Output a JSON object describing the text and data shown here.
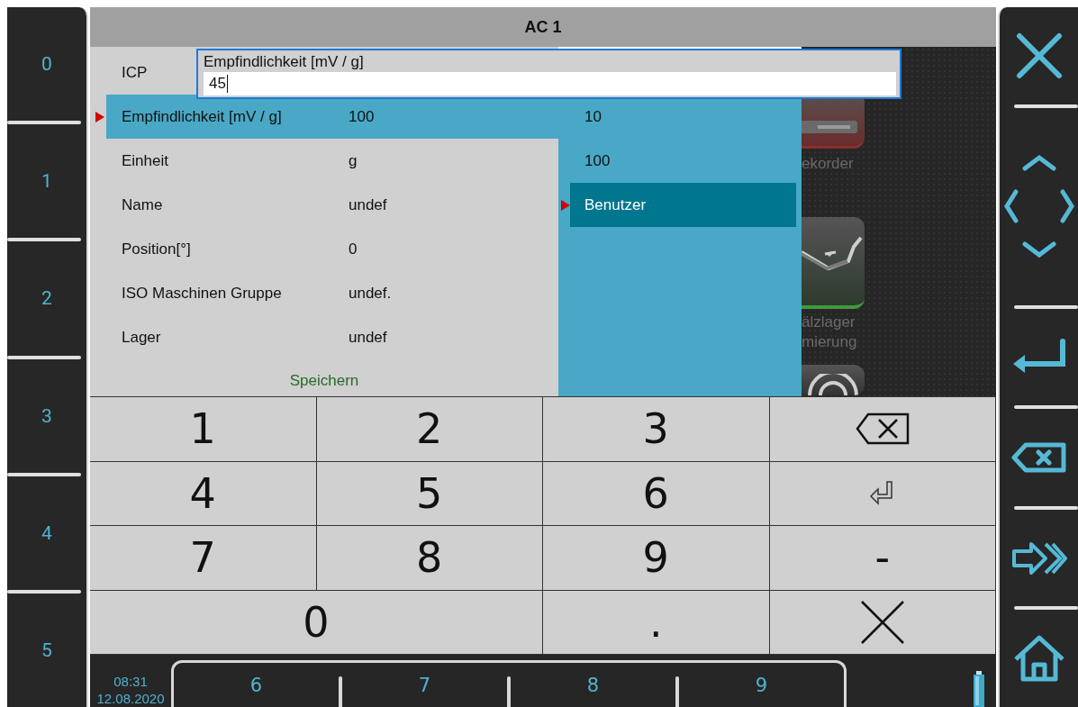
{
  "left_keys": [
    "0",
    "1",
    "2",
    "3",
    "4",
    "5"
  ],
  "window": {
    "title": "AC 1"
  },
  "settings": [
    {
      "label": "ICP",
      "selected": false
    },
    {
      "label": "Empfindlichkeit [mV / g]",
      "value": "100",
      "selected": true
    },
    {
      "label": "Einheit",
      "value": "g",
      "selected": false
    },
    {
      "label": "Name",
      "value": "undef",
      "selected": false
    },
    {
      "label": "Position[°]",
      "value": "0",
      "selected": false
    },
    {
      "label": "ISO Maschinen Gruppe",
      "value": "undef.",
      "selected": false
    },
    {
      "label": "Lager",
      "value": "undef",
      "selected": false
    }
  ],
  "save_button": "Speichern",
  "dropdown": [
    {
      "label": "10",
      "selected": false
    },
    {
      "label": "100",
      "selected": false
    },
    {
      "label": "Benutzer",
      "selected": true
    }
  ],
  "apps": [
    {
      "kind": "recorder",
      "lines": [
        "ekorder"
      ]
    },
    {
      "kind": "oiler",
      "lines": [
        "älzlager",
        "mierung"
      ]
    },
    {
      "kind": "signal"
    }
  ],
  "editor": {
    "label": "Empfindlichkeit [mV / g]",
    "value": "45"
  },
  "keypad": [
    {
      "kind": "digit",
      "label": "1"
    },
    {
      "kind": "digit",
      "label": "2"
    },
    {
      "kind": "digit",
      "label": "3"
    },
    {
      "kind": "backspace"
    },
    {
      "kind": "digit",
      "label": "4"
    },
    {
      "kind": "digit",
      "label": "5"
    },
    {
      "kind": "digit",
      "label": "6"
    },
    {
      "kind": "enter"
    },
    {
      "kind": "digit",
      "label": "7"
    },
    {
      "kind": "digit",
      "label": "8"
    },
    {
      "kind": "digit",
      "label": "9"
    },
    {
      "kind": "digit",
      "label": "-"
    },
    {
      "kind": "wide",
      "label": "0"
    },
    {
      "kind": "digit",
      "label": "."
    },
    {
      "kind": "close"
    }
  ],
  "status": {
    "time": "08:31",
    "date": "12.08.2020"
  },
  "soft_keys": [
    "6",
    "7",
    "8",
    "9"
  ],
  "right_keys": [
    {
      "kind": "close"
    },
    {
      "kind": "arrows"
    },
    {
      "kind": "enter"
    },
    {
      "kind": "delete"
    },
    {
      "kind": "forward"
    },
    {
      "kind": "home"
    }
  ]
}
